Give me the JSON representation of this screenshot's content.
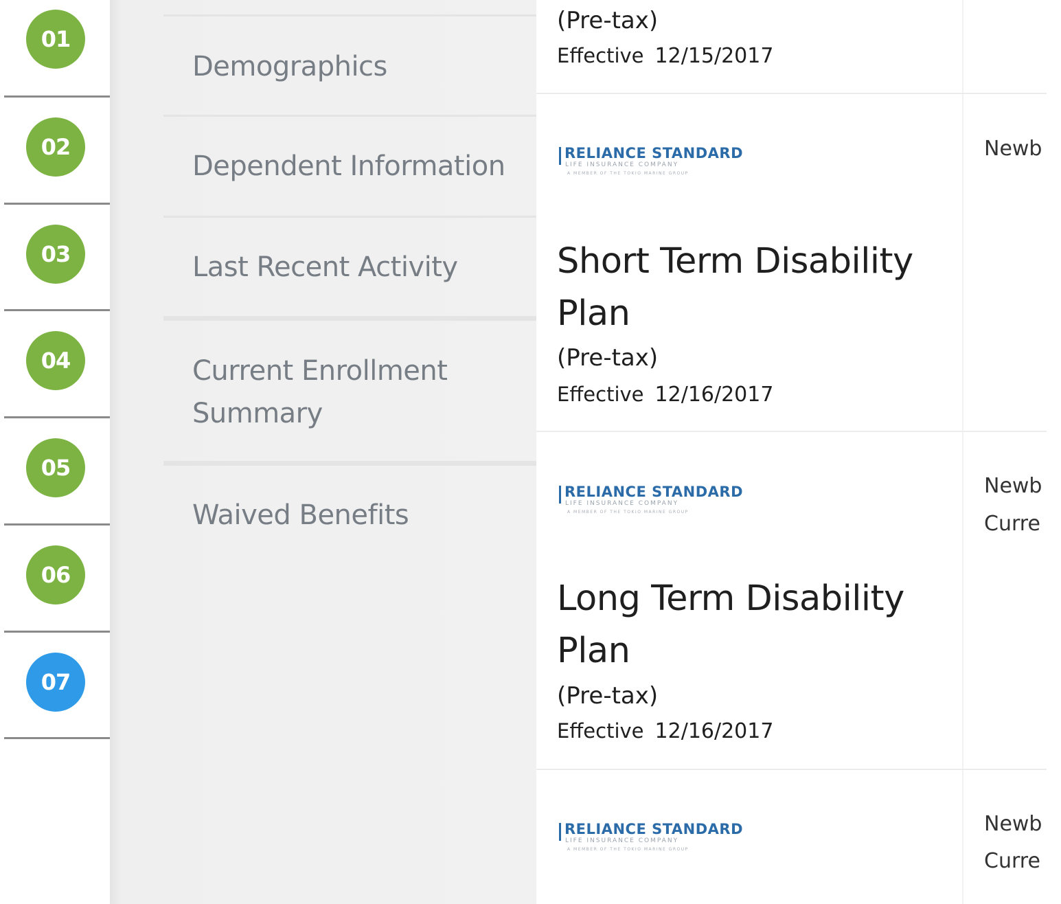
{
  "steps": [
    {
      "number": "01",
      "state": "complete"
    },
    {
      "number": "02",
      "state": "complete"
    },
    {
      "number": "03",
      "state": "complete"
    },
    {
      "number": "04",
      "state": "complete"
    },
    {
      "number": "05",
      "state": "complete"
    },
    {
      "number": "06",
      "state": "complete"
    },
    {
      "number": "07",
      "state": "active"
    }
  ],
  "section_nav": {
    "items": [
      {
        "label": "Demographics"
      },
      {
        "label": "Dependent Information"
      },
      {
        "label": "Last Recent Activity"
      },
      {
        "label": "Current Enrollment Summary"
      },
      {
        "label": "Waived Benefits"
      }
    ]
  },
  "plans": [
    {
      "tax_label": "(Pre-tax)",
      "effective_label": "Effective",
      "effective_date": "12/15/2017"
    },
    {
      "carrier_logo": {
        "brand": "RELIANCE STANDARD",
        "subtitle": "LIFE INSURANCE COMPANY",
        "tagline": "A MEMBER OF THE TOKIO MARINE GROUP"
      },
      "name": "Short Term Disability Plan",
      "tax_label": "(Pre-tax)",
      "effective_label": "Effective",
      "effective_date": "12/16/2017",
      "status_lines": [
        "Newb"
      ]
    },
    {
      "carrier_logo": {
        "brand": "RELIANCE STANDARD",
        "subtitle": "LIFE INSURANCE COMPANY",
        "tagline": "A MEMBER OF THE TOKIO MARINE GROUP"
      },
      "name": "Long Term Disability Plan",
      "tax_label": "(Pre-tax)",
      "effective_label": "Effective",
      "effective_date": "12/16/2017",
      "status_lines": [
        "Newb",
        "Curre"
      ]
    },
    {
      "carrier_logo": {
        "brand": "RELIANCE STANDARD",
        "subtitle": "LIFE INSURANCE COMPANY",
        "tagline": "A MEMBER OF THE TOKIO MARINE GROUP"
      },
      "status_lines": [
        "Newb",
        "Curre"
      ]
    }
  ],
  "colors": {
    "step_complete": "#7cb342",
    "step_active": "#2f9be8",
    "nav_text": "#777d84",
    "logo_blue": "#2b6ca8"
  }
}
